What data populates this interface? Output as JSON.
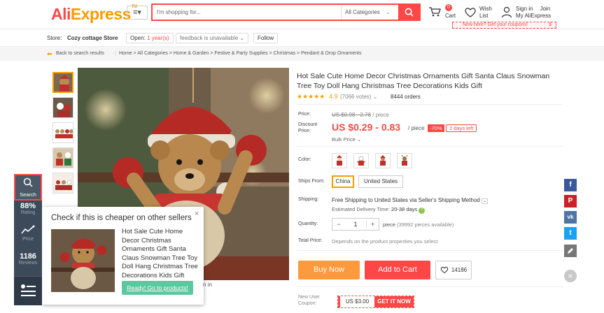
{
  "header": {
    "logo_part1": "Ali",
    "logo_part2": "Express",
    "logo_tm": "TM",
    "search_placeholder": "I'm shopping for...",
    "category": "All Categories",
    "cart_label": "Cart",
    "cart_count": "0",
    "wish_label_1": "Wish",
    "wish_label_2": "List",
    "signin": "Sign in",
    "join": "Join",
    "my_ali": "My AliExpress",
    "coupon_text": "New here? Get your coupons!",
    "coupon_amount": "$"
  },
  "store": {
    "label": "Store:",
    "name": "Cozy cottage Store",
    "open": "Open:",
    "years": "1 year(s)",
    "feedback": "feedback is unavailable",
    "follow": "Follow"
  },
  "breadcrumb": {
    "back": "Back to search results",
    "path": "Home > All Categories > Home & Garden > Festive & Party Supplies > Christmas > Pendant & Drop Ornaments"
  },
  "product": {
    "title": "Hot Sale Cute Home Decor Christmas Ornaments Gift Santa Claus Snowman Tree Toy Doll Hang Christmas Tree Decorations Kids Gift",
    "stars": "★★★★★",
    "rating": "4.9",
    "votes": "(7066 votes)",
    "orders": "8444 orders",
    "price_label": "Price:",
    "orig_price": "US $0.98 - 2.78",
    "per_piece": "/ piece",
    "discount_label_1": "Discount",
    "discount_label_2": "Price:",
    "price": "US $0.29 - 0.83",
    "discount_per": "/ piece",
    "discount_pct": "-70%",
    "days_left": "2 days left",
    "bulk": "Bulk Price",
    "color_label": "Color:",
    "ships_from_label": "Ships From:",
    "ship_opt1": "China",
    "ship_opt2": "United States",
    "shipping_label": "Shipping:",
    "shipping_text": "Free Shipping to United States via Seller's Shipping Method",
    "delivery_label": "Estimated Delivery Time:",
    "delivery_time": "20-38 days",
    "quantity_label": "Quantity:",
    "qty_minus": "−",
    "qty_value": "1",
    "qty_plus": "+",
    "qty_unit": "piece",
    "qty_avail": "(39992 pieces available)",
    "total_label": "Total Price:",
    "total_text": "Depends on the product properties you select",
    "buy_now": "Buy Now",
    "add_cart": "Add to Cart",
    "wish_count": "14186",
    "new_user_1": "New User",
    "new_user_2": "Coupon:",
    "coupon_value": "US $3.00",
    "get_it": "GET IT NOW"
  },
  "popup": {
    "title": "Check if this is cheaper on other sellers",
    "desc": "Hot Sale Cute Home Decor Christmas Ornaments Gift Santa Claus Snowman Tree Toy Doll Hang Christmas Tree Decorations Kids Gift",
    "close": "×",
    "cta": "Ready! Go to products!"
  },
  "toolbar": {
    "search": "Search",
    "rating_value": "88%",
    "rating_label": "Rating",
    "price_label": "Price",
    "reviews_value": "1186",
    "reviews_label": "Reviews"
  },
  "social": [
    "f",
    "P",
    "vk",
    "t"
  ],
  "bottom_text": "n in",
  "colors": {
    "accent": "#ff4747",
    "orange": "#ff9a00",
    "toolbar": "#3d4a5a"
  }
}
